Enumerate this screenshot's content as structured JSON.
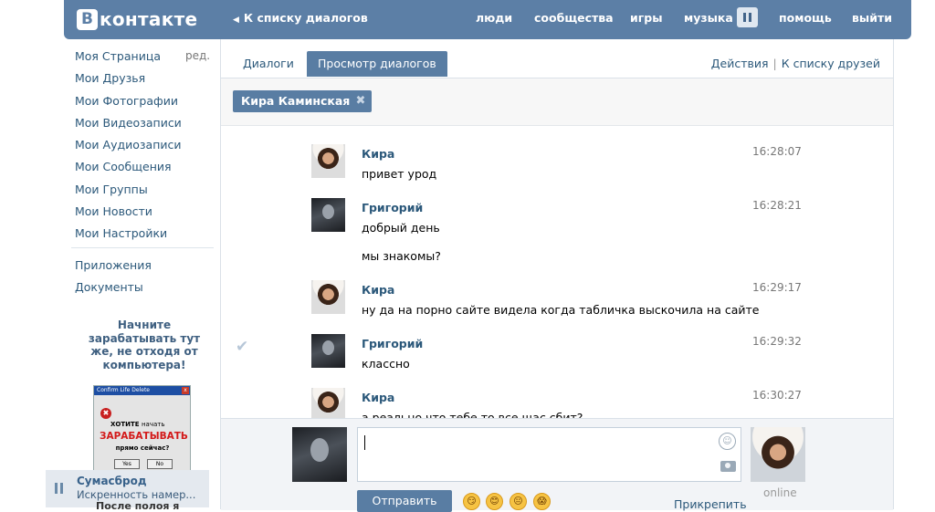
{
  "header": {
    "logo_letter": "В",
    "logo_text": "контакте",
    "back_link": "К списку диалогов",
    "nav": [
      "люди",
      "сообщества",
      "игры",
      "музыка",
      "помощь",
      "выйти"
    ],
    "brand_color": "#5c7fa6"
  },
  "sidebar": {
    "items": [
      "Моя Страница",
      "Мои Друзья",
      "Мои Фотографии",
      "Мои Видеозаписи",
      "Мои Аудиозаписи",
      "Мои Сообщения",
      "Мои Группы",
      "Мои Новости",
      "Мои Настройки"
    ],
    "edit_label": "ред.",
    "extra_items": [
      "Приложения",
      "Документы"
    ]
  },
  "ad": {
    "title": "Начните зарабатывать тут же, не отходя от компьютера!",
    "dialog_title": "Confirm Life Delete",
    "dialog_icon": "✖",
    "dialog_line1": "ХОТИТЕ",
    "dialog_line1b": "начать",
    "dialog_line2": "ЗАРАБАТЫВАТЬ",
    "dialog_line3": "прямо сейчас?",
    "dialog_yes": "Yes",
    "dialog_no": "No",
    "more_text": "После полоя я"
  },
  "player": {
    "title": "Сумасброд",
    "subtitle": "Искренность намер..."
  },
  "tabs": [
    {
      "label": "Диалоги",
      "active": false
    },
    {
      "label": "Просмотр диалогов",
      "active": true
    }
  ],
  "actions": {
    "label": "Действия",
    "friends_link": "К списку друзей",
    "separator": "|"
  },
  "filter_chip": {
    "label": "Кира Каминская",
    "close": "✖"
  },
  "messages": [
    {
      "author": "Кира",
      "time": "16:28:07",
      "lines": [
        "привет урод"
      ],
      "avatar": "kira"
    },
    {
      "author": "Григорий",
      "time": "16:28:21",
      "lines": [
        "добрый день",
        "мы знакомы?"
      ],
      "avatar": "grigoriy"
    },
    {
      "author": "Кира",
      "time": "16:29:17",
      "lines": [
        "ну да на порно сайте видела когда табличка выскочила на сайте"
      ],
      "avatar": "kira"
    },
    {
      "author": "Григорий",
      "time": "16:29:32",
      "lines": [
        "классно"
      ],
      "avatar": "grigoriy",
      "read_check": true
    },
    {
      "author": "Кира",
      "time": "16:30:27",
      "lines": [
        "а реально что тебе то все щас сбит?"
      ],
      "avatar": "kira"
    }
  ],
  "check_icon": "✔",
  "compose": {
    "input_value": "",
    "send_label": "Отправить",
    "attach_label": "Прикрепить",
    "peer_status": "online",
    "smile_icon": "☺",
    "emojis": [
      "😏",
      "😊",
      "😐",
      "😱"
    ]
  }
}
